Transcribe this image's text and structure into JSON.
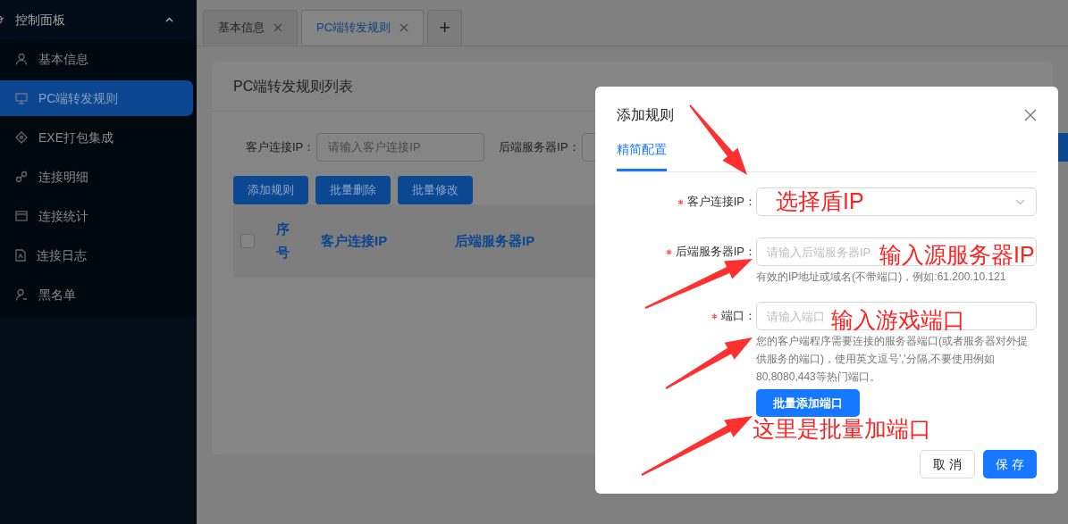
{
  "sidebar": {
    "header": "控制面板",
    "items": [
      {
        "label": "基本信息",
        "selected": false
      },
      {
        "label": "PC端转发规则",
        "selected": true
      },
      {
        "label": "EXE打包集成",
        "selected": false
      },
      {
        "label": "连接明细",
        "selected": false
      },
      {
        "label": "连接统计",
        "selected": false
      },
      {
        "label": "连接日志",
        "selected": false
      },
      {
        "label": "黑名单",
        "selected": false
      }
    ]
  },
  "tabs": [
    {
      "label": "基本信息",
      "selected": false
    },
    {
      "label": "PC端转发规则",
      "selected": true
    }
  ],
  "add_tab": "+",
  "card": {
    "title": "PC端转发规则列表",
    "filters": [
      {
        "label": "客户连接IP：",
        "placeholder": "请输入客户连接IP"
      },
      {
        "label": "后端服务器IP："
      }
    ],
    "buttons": [
      "添加规则",
      "批量删除",
      "批量修改"
    ],
    "table": {
      "select_all_checked": false,
      "columns": [
        "序号",
        "客户连接IP",
        "后端服务器IP"
      ]
    }
  },
  "dialog": {
    "title": "添加规则",
    "tabs": [
      {
        "label": "精简配置",
        "selected": true
      }
    ],
    "fields": [
      {
        "kind": "select",
        "label": "客户连接IP：",
        "required": true
      },
      {
        "kind": "input",
        "label": "后端服务器IP：",
        "required": true,
        "placeholder": "请输入后端服务器IP",
        "hint": "有效的IP地址或域名(不带端口)，例如:61.200.10.121"
      },
      {
        "kind": "input",
        "label": "端口：",
        "required": true,
        "placeholder": "请输入端口",
        "hint": "您的客户端程序需要连接的服务器端口(或者服务器对外提供服务的端口)，使用英文逗号','分隔,不要使用例如80,8080,443等热门端口。"
      }
    ],
    "batch_button": "批量添加端口",
    "buttons": [
      {
        "kind": "default",
        "label": "取 消"
      },
      {
        "kind": "primary",
        "label": "保 存"
      }
    ]
  },
  "annotations": [
    "选择盾IP",
    "输入源服务器IP",
    "输入游戏端口",
    "这里是批量加端口"
  ]
}
